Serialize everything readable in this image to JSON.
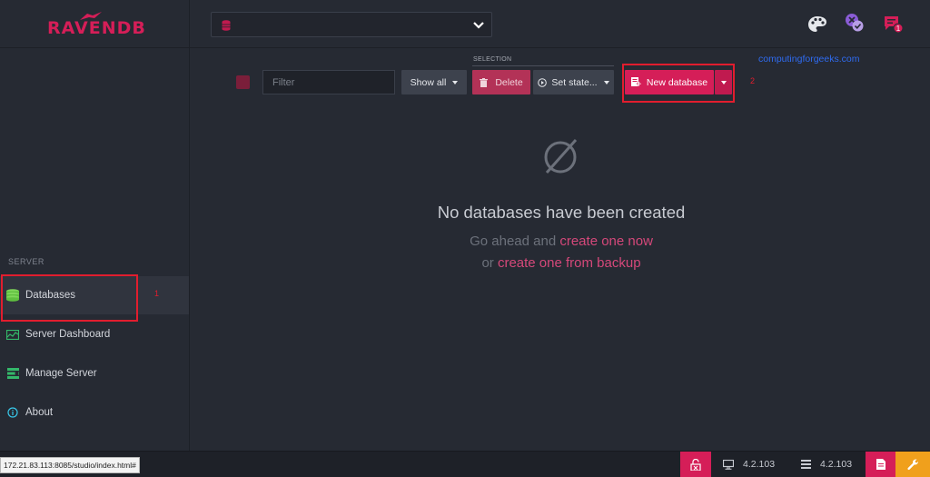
{
  "app": {
    "logo_text": "RAVENDB"
  },
  "sidebar": {
    "section_label": "SERVER",
    "items": [
      {
        "label": "Databases",
        "icon": "database-icon",
        "active": true
      },
      {
        "label": "Server Dashboard",
        "icon": "dashboard-icon"
      },
      {
        "label": "Manage Server",
        "icon": "manage-server-icon"
      },
      {
        "label": "About",
        "icon": "info-icon"
      }
    ]
  },
  "header": {
    "database_select": {
      "value": ""
    },
    "icons": [
      "theme-palette-icon",
      "cluster-status-icon",
      "notifications-icon"
    ],
    "notification_count": "1"
  },
  "toolbar": {
    "filter_placeholder": "Filter",
    "show_all_label": "Show all",
    "selection_label": "SELECTION",
    "delete_label": "Delete",
    "set_state_label": "Set state...",
    "new_database_label": "New database"
  },
  "empty_state": {
    "title": "No databases have been created",
    "line1_prefix": "Go ahead and",
    "line1_link": "create one now",
    "line2_prefix": "or",
    "line2_link": "create one from backup"
  },
  "annotations": {
    "marker_1": "1",
    "marker_2": "2",
    "watermark": "computingforgeeks.com"
  },
  "statusbar": {
    "url": "172.21.83.113:8085/studio/index.html#",
    "client_version": "4.2.103",
    "server_version": "4.2.103"
  },
  "colors": {
    "accent": "#d51e58",
    "background": "#262a33",
    "annotation": "#e11d2e",
    "watermark": "#2f6bf0"
  }
}
